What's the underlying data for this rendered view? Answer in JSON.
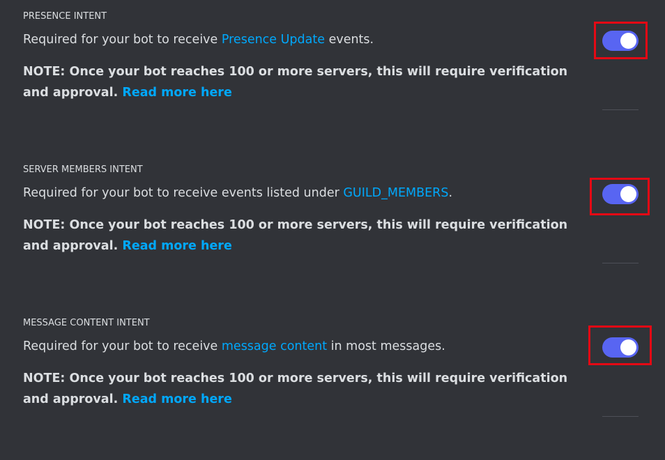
{
  "intents": [
    {
      "title": "PRESENCE INTENT",
      "desc_prefix": "Required for your bot to receive ",
      "desc_link": "Presence Update",
      "desc_suffix": " events.",
      "note_text": "NOTE: Once your bot reaches 100 or more servers, this will require verification and approval. ",
      "note_link": "Read more here",
      "enabled": true
    },
    {
      "title": "SERVER MEMBERS INTENT",
      "desc_prefix": "Required for your bot to receive events listed under ",
      "desc_link": "GUILD_MEMBERS",
      "desc_suffix": ".",
      "note_text": "NOTE: Once your bot reaches 100 or more servers, this will require verification and approval. ",
      "note_link": "Read more here",
      "enabled": true
    },
    {
      "title": "MESSAGE CONTENT INTENT",
      "desc_prefix": "Required for your bot to receive ",
      "desc_link": "message content",
      "desc_suffix": " in most messages.",
      "note_text": "NOTE: Once your bot reaches 100 or more servers, this will require verification and approval. ",
      "note_link": "Read more here",
      "enabled": true
    }
  ],
  "colors": {
    "background": "#313338",
    "text": "#dbdee1",
    "link": "#00a8fc",
    "toggle_on": "#5865f2",
    "highlight": "#e50914"
  }
}
